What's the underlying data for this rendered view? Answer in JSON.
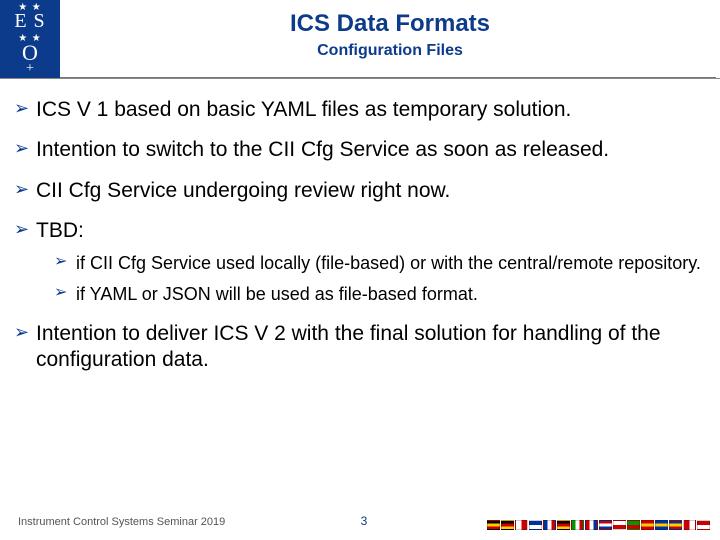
{
  "header": {
    "logo_line1": "E S",
    "logo_line2": "O",
    "title": "ICS Data Formats",
    "subtitle": "Configuration Files"
  },
  "bullets": [
    {
      "text": "ICS V 1 based on basic YAML files as temporary solution."
    },
    {
      "text": "Intention to switch to the CII Cfg Service as soon as released."
    },
    {
      "text": "CII Cfg Service undergoing review right now."
    },
    {
      "text": "TBD:",
      "sub": [
        "if CII Cfg Service used locally (file-based) or with the central/remote repository.",
        "if YAML or JSON will be used as file-based format."
      ]
    },
    {
      "text": "Intention to deliver ICS V 2 with the final solution for handling of the configuration data."
    }
  ],
  "footer": {
    "text": "Instrument Control Systems Seminar 2019",
    "page": "3"
  },
  "flag_colors": [
    "linear-gradient(#000 33%, #fc0 33% 66%, #c00 66%)",
    "linear-gradient(#000 33%, #c00 33% 66%, #fc0 66%)",
    "linear-gradient(90deg,#fff 50%,#c00 50%)",
    "linear-gradient(#039 50%,#fff 50%)",
    "linear-gradient(90deg,#039 33%,#fff 33% 66%,#c00 66%)",
    "linear-gradient(#000 33%,#c00 33% 66%,#fc0 66%)",
    "linear-gradient(90deg,#090 33%,#fff 33% 66%,#c00 66%)",
    "linear-gradient(90deg,#c00 33%,#fff 33% 66%,#039 66%)",
    "linear-gradient(#c00 33%,#fff 33% 66%,#039 66%)",
    "linear-gradient(#fff 50%,#c00 50%)",
    "linear-gradient(#090 50%,#c00 50%)",
    "linear-gradient(#c00 33%,#fc0 33% 66%,#c00 66%)",
    "linear-gradient(#039 33%,#fc0 33% 66%,#039 66%)",
    "linear-gradient(#039 33%,#fc0 33% 66%,#c00 66%)",
    "linear-gradient(90deg,#c00 50%,#fff 50%)",
    "linear-gradient(#c00 50%,#fff 50%)"
  ]
}
